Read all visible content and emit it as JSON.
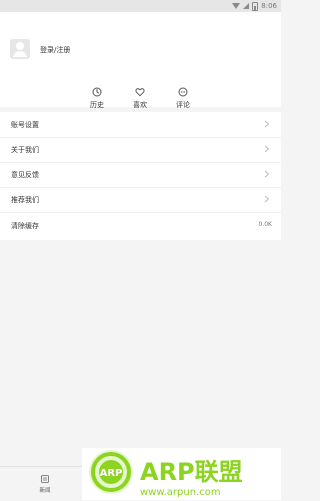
{
  "status": {
    "time": "8:06"
  },
  "profile": {
    "login": "登录/注册"
  },
  "actions": [
    {
      "label": "历史",
      "icon": "clock-icon"
    },
    {
      "label": "喜欢",
      "icon": "heart-icon"
    },
    {
      "label": "评论",
      "icon": "comment-icon"
    }
  ],
  "menu": [
    {
      "label": "账号设置",
      "type": "chevron"
    },
    {
      "label": "关于我们",
      "type": "chevron"
    },
    {
      "label": "意见反馈",
      "type": "chevron"
    },
    {
      "label": "推荐我们",
      "type": "chevron"
    },
    {
      "label": "清除缓存",
      "value": "0.0K"
    }
  ],
  "tabbar": {
    "news": "新闻"
  },
  "watermark": {
    "arp_badge": "ARP",
    "brand": "ARP联盟",
    "url": "www.arpun.com"
  },
  "colors": {
    "status_bg": "#e6e6e6",
    "page_bg": "#f4f4f4",
    "card_bg": "#ffffff",
    "text": "#333333",
    "muted": "#777777",
    "watermark_green": "#8bd41f"
  }
}
